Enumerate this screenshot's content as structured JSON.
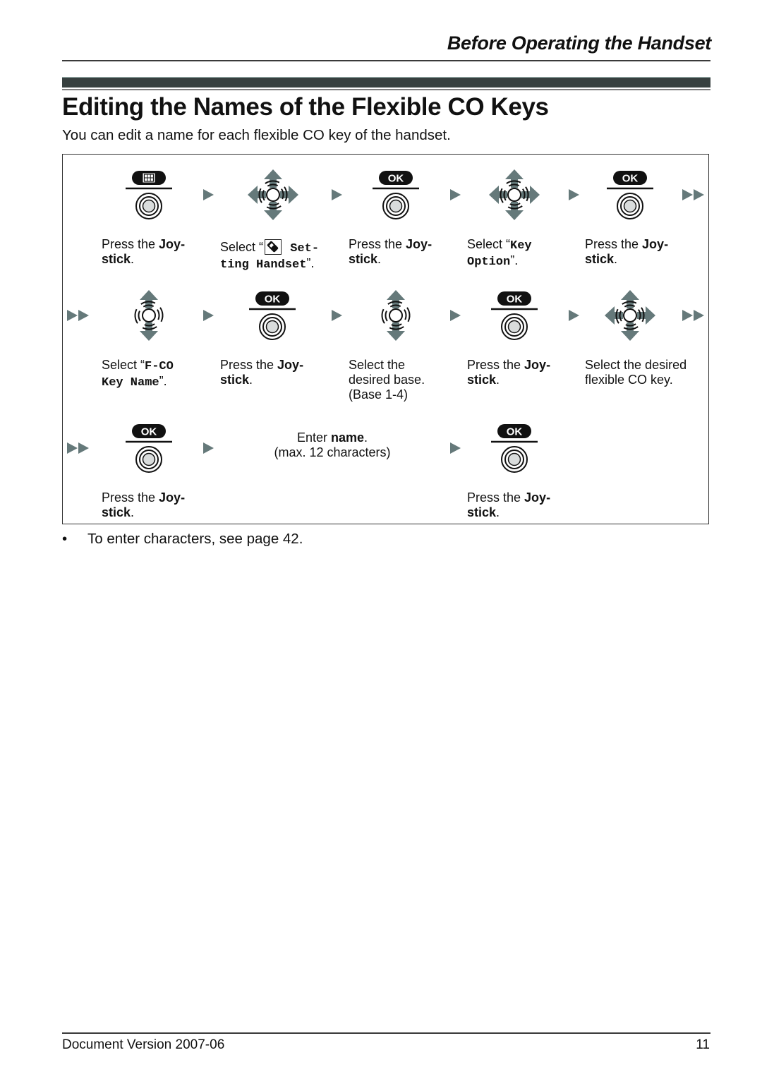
{
  "header": {
    "section_title": "Before Operating the Handset"
  },
  "page": {
    "title": "Editing the Names of the Flexible CO Keys",
    "intro": "You can edit a name for each flexible CO key of the handset."
  },
  "procedure": {
    "steps": [
      {
        "icon": "menu-key-joystick-press-icon",
        "key_label": "",
        "text_before": "Press the ",
        "bold": "Joy-",
        "line2_bold": "stick",
        "line2_after": "."
      },
      {
        "icon": "joystick-4way-icon",
        "text_before": "Select “",
        "glyph": "settings-handset-icon",
        "mono1": " Set-",
        "mono2": "ting Handset",
        "after": "”."
      },
      {
        "icon": "ok-key-joystick-press-icon",
        "key_label": "OK",
        "text_before": "Press the ",
        "bold": "Joy-",
        "line2_bold": "stick",
        "line2_after": "."
      },
      {
        "icon": "joystick-4way-icon",
        "text_before": "Select “",
        "mono1": "Key",
        "mono2": "Option",
        "after": "”."
      },
      {
        "icon": "ok-key-joystick-press-icon",
        "key_label": "OK",
        "text_before": "Press the ",
        "bold": "Joy-",
        "line2_bold": "stick",
        "line2_after": "."
      },
      {
        "icon": "joystick-updown-icon",
        "text_before": "Select “",
        "mono1": "F-CO",
        "mono2": "Key Name",
        "after": "”."
      },
      {
        "icon": "ok-key-joystick-press-icon",
        "key_label": "OK",
        "text_before": "Press the ",
        "bold": "Joy-",
        "line2_bold": "stick",
        "line2_after": "."
      },
      {
        "icon": "joystick-updown-icon",
        "line1": "Select the",
        "line2": "desired base.",
        "line3": "(Base 1-4)"
      },
      {
        "icon": "ok-key-joystick-press-icon",
        "key_label": "OK",
        "text_before": "Press the ",
        "bold": "Joy-",
        "line2_bold": "stick",
        "line2_after": "."
      },
      {
        "icon": "joystick-4way-icon",
        "line1": "Select the desired",
        "line2": "flexible CO key."
      },
      {
        "icon": "ok-key-joystick-press-icon",
        "key_label": "OK",
        "text_before": "Press the ",
        "bold": "Joy-",
        "line2_bold": "stick",
        "line2_after": "."
      },
      {
        "icon": "text-entry",
        "line1_before": "Enter ",
        "line1_bold": "name",
        "line1_after": ".",
        "line2": "(max. 12 characters)"
      },
      {
        "icon": "ok-key-joystick-press-icon",
        "key_label": "OK",
        "text_before": "Press the ",
        "bold": "Joy-",
        "line2_bold": "stick",
        "line2_after": "."
      }
    ]
  },
  "note": {
    "bullet": "•",
    "text": "To enter characters, see page 42."
  },
  "footer": {
    "version": "Document Version 2007-06",
    "page_number": "11"
  },
  "colors": {
    "arrow": "#65797a",
    "title_bar": "#37403f",
    "key_black": "#111111",
    "joystick_center": "#d9dcdc"
  }
}
